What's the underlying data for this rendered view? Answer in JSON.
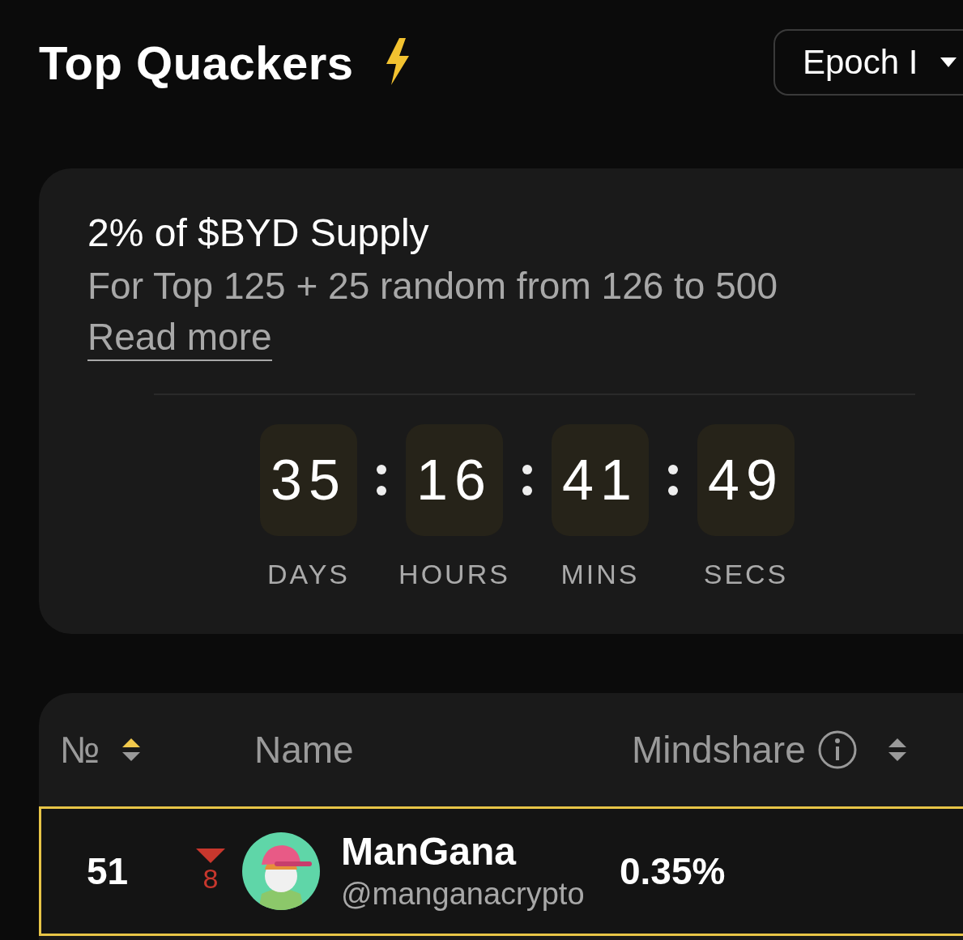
{
  "header": {
    "title": "Top Quackers",
    "epoch_selector": {
      "value": "Epoch I"
    }
  },
  "reward_card": {
    "title": "2% of $BYD Supply",
    "subtitle": "For Top 125 + 25 random from 126 to 500",
    "link": "Read more",
    "countdown": [
      {
        "value": "35",
        "unit": "DAYS"
      },
      {
        "value": "16",
        "unit": "HOURS"
      },
      {
        "value": "41",
        "unit": "MINS"
      },
      {
        "value": "49",
        "unit": "SECS"
      }
    ]
  },
  "table": {
    "columns": [
      {
        "label": "№",
        "kind": "sortable",
        "sorted": true
      },
      {
        "label": "Name",
        "kind": "plain"
      },
      {
        "label": "Mindshare",
        "kind": "info-sortable",
        "sorted": false
      }
    ],
    "rows": [
      {
        "rank": "51",
        "change": {
          "kind": "down",
          "amount": "8"
        },
        "name": "ManGana",
        "handle": "@manganacrypto",
        "mindshare": "0.35%",
        "selected": true
      }
    ]
  }
}
